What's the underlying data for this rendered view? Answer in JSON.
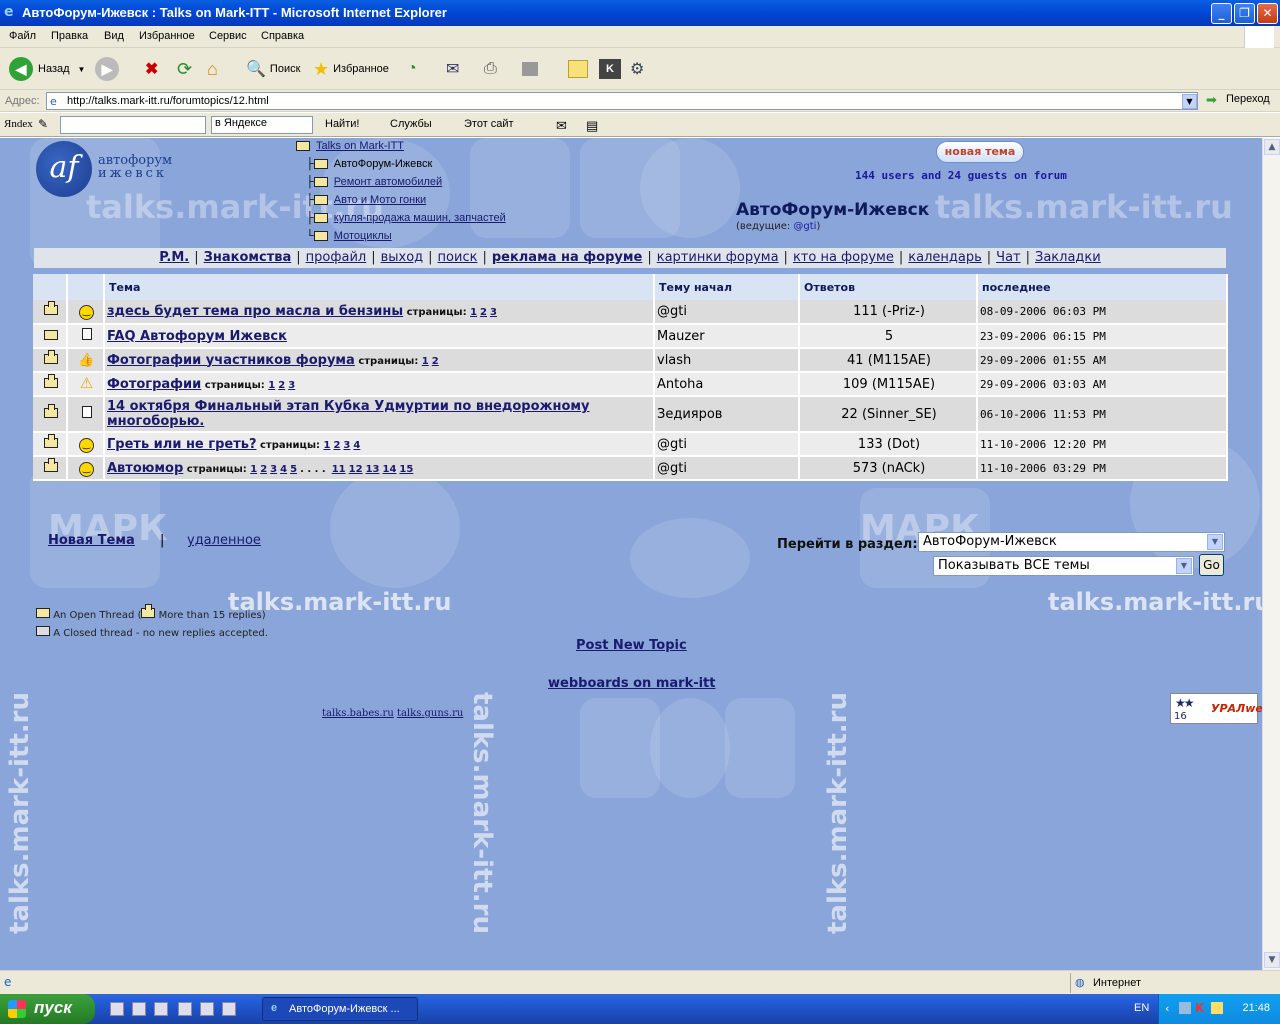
{
  "window": {
    "title": "АвтоФорум-Ижевск : Talks on Mark-ITT - Microsoft Internet Explorer",
    "minimize_icon": "_",
    "maximize_icon": "❐",
    "close_icon": "✕"
  },
  "menu": [
    "Файл",
    "Правка",
    "Вид",
    "Избранное",
    "Сервис",
    "Справка"
  ],
  "toolbar": {
    "back": "Назад",
    "search": "Поиск",
    "favorites": "Избранное"
  },
  "address": {
    "label": "Адрес:",
    "url": "http://talks.mark-itt.ru/forumtopics/12.html",
    "go": "Переход"
  },
  "yandex": {
    "logo": "Яndex",
    "search_value": "",
    "scope": "в Яндексе",
    "find": "Найти!",
    "services": "Службы",
    "this_site": "Этот сайт"
  },
  "page": {
    "logo_letters": "af",
    "logo_line1": "автофорум",
    "logo_line2": "ижевск",
    "tree": {
      "root": "Talks on Mark-ITT",
      "current": "АвтоФорум-Ижевск",
      "items": [
        "Ремонт автомобилей",
        "Авто и Мото гонки",
        "купля-продажа машин, запчастей",
        "Мотоциклы"
      ]
    },
    "new_topic_btn": "новая тема",
    "users_online": "144 users and 24 guests on forum",
    "forum_title": "АвтоФорум-Ижевск",
    "moderators_label": "(ведущие: ",
    "moderator": "@gti",
    "moderators_end": ")",
    "watermark": "talks.mark-itt.ru",
    "watermark_brand": "МАРК"
  },
  "nav": [
    {
      "label": "P.M.",
      "bold": true
    },
    {
      "label": "Знакомства",
      "bold": true
    },
    {
      "label": "профайл",
      "bold": false
    },
    {
      "label": "выход",
      "bold": false
    },
    {
      "label": "поиск",
      "bold": false
    },
    {
      "label": "реклама на форуме",
      "bold": true
    },
    {
      "label": "картинки форума",
      "bold": false
    },
    {
      "label": "кто на форуме",
      "bold": false
    },
    {
      "label": "календарь",
      "bold": false
    },
    {
      "label": "Чат",
      "bold": false
    },
    {
      "label": "Закладки",
      "bold": false
    }
  ],
  "table": {
    "headers": {
      "topic": "Тема",
      "author": "Тему начал",
      "replies": "Ответов",
      "last": "последнее"
    },
    "pages_label": "страницы:",
    "rows": [
      {
        "icon": "hot",
        "emoticon": "smile",
        "topic": "здесь будет тема про масла и бензины",
        "pages": [
          "1",
          "2",
          "3"
        ],
        "author": "@gti",
        "replies": "111 (-Priz-)",
        "last": "08-09-2006 06:03 PM"
      },
      {
        "icon": "open",
        "emoticon": "doc",
        "topic": "FAQ Автофорум Ижевск",
        "pages": [],
        "author": "Mauzer",
        "replies": "5",
        "last": "23-09-2006 06:15 PM"
      },
      {
        "icon": "hot",
        "emoticon": "thumb",
        "topic": "Фотографии участников форума",
        "pages": [
          "1",
          "2"
        ],
        "author": "vlash",
        "replies": "41 (M115AE)",
        "last": "29-09-2006 01:55 AM"
      },
      {
        "icon": "hot",
        "emoticon": "warn",
        "topic": "Фотографии",
        "pages": [
          "1",
          "2",
          "3"
        ],
        "author": "Antoha",
        "replies": "109 (M115AE)",
        "last": "29-09-2006 03:03 AM"
      },
      {
        "icon": "hot",
        "emoticon": "doc",
        "topic": "14 октября Финальный этап Кубка Удмуртии по внедорожному многоборью.",
        "pages": [],
        "author": "Зедияров",
        "replies": "22 (Sinner_SE)",
        "last": "06-10-2006 11:53 PM"
      },
      {
        "icon": "hot",
        "emoticon": "smile",
        "topic": "Греть или не греть?",
        "pages": [
          "1",
          "2",
          "3",
          "4"
        ],
        "author": "@gti",
        "replies": "133 (Dot)",
        "last": "11-10-2006 12:20 PM"
      },
      {
        "icon": "hot",
        "emoticon": "smile",
        "topic": "Автоюмор",
        "pages": [
          "1",
          "2",
          "3",
          "4",
          "5",
          ". . . .",
          "11",
          "12",
          "13",
          "14",
          "15"
        ],
        "author": "@gti",
        "replies": "573 (nACk)",
        "last": "11-10-2006 03:29 PM"
      }
    ]
  },
  "bottom": {
    "new_topic": "Новая Тема",
    "separator": "|",
    "deleted": "удаленное",
    "jump_label": "Перейти в раздел:",
    "jump_value": "АвтоФорум-Ижевск",
    "filter_value": "Показывать ВСЕ темы",
    "go": "Go"
  },
  "legend": {
    "open_pre": "An Open Thread (",
    "open_post": "More than 15 replies)",
    "closed": "A Closed thread - no new replies accepted."
  },
  "links": {
    "post_new": "Post New Topic",
    "webboards": "webboards on mark-itt",
    "babes": "talks.babes.ru",
    "guns": "talks.guns.ru"
  },
  "counter": {
    "num": "16",
    "brand": "УРАЛweb"
  },
  "status": {
    "zone": "Интернет"
  },
  "taskbar": {
    "start": "пуск",
    "task": "АвтоФорум-Ижевск ...",
    "lang": "EN",
    "clock": "21:48"
  },
  "colors": {
    "content_bg": "#8aa5d9",
    "link": "#1a1a6e",
    "titlebar": "#0a5fe0"
  }
}
